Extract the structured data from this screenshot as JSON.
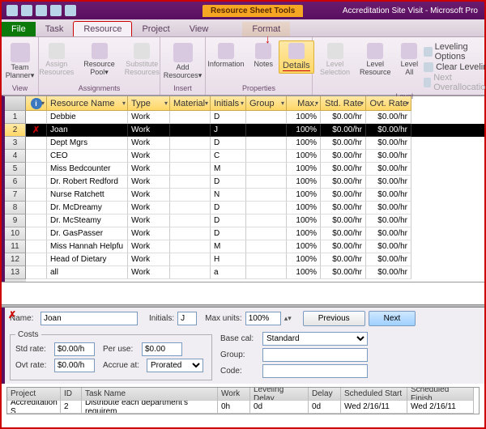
{
  "titlebar": {
    "tool_tab": "Resource Sheet Tools",
    "app_title": "Accreditation Site Visit - Microsoft Pro"
  },
  "tabs": {
    "file": "File",
    "task": "Task",
    "resource": "Resource",
    "project": "Project",
    "view": "View",
    "format": "Format"
  },
  "ribbon": {
    "team_planner": "Team\nPlanner▾",
    "assign": "Assign\nResources",
    "pool": "Resource\nPool▾",
    "substitute": "Substitute\nResources",
    "assignments": "Assignments",
    "add": "Add\nResources▾",
    "insert": "Insert",
    "info": "Information",
    "notes": "Notes",
    "details": "Details",
    "properties": "Properties",
    "lvl_sel": "Level\nSelection",
    "lvl_res": "Level\nResource",
    "lvl_all": "Level\nAll",
    "lvl_opts": "Leveling Options",
    "clear_lvl": "Clear Leveling",
    "next_over": "Next Overallocation",
    "level": "Level",
    "view_group": "View"
  },
  "columns": {
    "indicator": "i",
    "name": "Resource Name",
    "type": "Type",
    "material": "Material",
    "initials": "Initials",
    "group": "Group",
    "max": "Max.",
    "std": "Std. Rate",
    "ovt": "Ovt. Rate"
  },
  "rows": [
    {
      "n": "1",
      "name": "Debbie",
      "type": "Work",
      "init": "D",
      "max": "100%",
      "std": "$0.00/hr",
      "ovt": "$0.00/hr"
    },
    {
      "n": "2",
      "name": "Joan",
      "type": "Work",
      "init": "J",
      "max": "100%",
      "std": "$0.00/hr",
      "ovt": "$0.00/hr",
      "selected": true,
      "ind": "✗"
    },
    {
      "n": "3",
      "name": "Dept Mgrs",
      "type": "Work",
      "init": "D",
      "max": "100%",
      "std": "$0.00/hr",
      "ovt": "$0.00/hr"
    },
    {
      "n": "4",
      "name": "CEO",
      "type": "Work",
      "init": "C",
      "max": "100%",
      "std": "$0.00/hr",
      "ovt": "$0.00/hr"
    },
    {
      "n": "5",
      "name": "Miss Bedcounter",
      "type": "Work",
      "init": "M",
      "max": "100%",
      "std": "$0.00/hr",
      "ovt": "$0.00/hr"
    },
    {
      "n": "6",
      "name": "Dr. Robert Redford",
      "type": "Work",
      "init": "D",
      "max": "100%",
      "std": "$0.00/hr",
      "ovt": "$0.00/hr"
    },
    {
      "n": "7",
      "name": "Nurse Ratchett",
      "type": "Work",
      "init": "N",
      "max": "100%",
      "std": "$0.00/hr",
      "ovt": "$0.00/hr"
    },
    {
      "n": "8",
      "name": "Dr. McDreamy",
      "type": "Work",
      "init": "D",
      "max": "100%",
      "std": "$0.00/hr",
      "ovt": "$0.00/hr"
    },
    {
      "n": "9",
      "name": "Dr. McSteamy",
      "type": "Work",
      "init": "D",
      "max": "100%",
      "std": "$0.00/hr",
      "ovt": "$0.00/hr"
    },
    {
      "n": "10",
      "name": "Dr. GasPasser",
      "type": "Work",
      "init": "D",
      "max": "100%",
      "std": "$0.00/hr",
      "ovt": "$0.00/hr"
    },
    {
      "n": "11",
      "name": "Miss Hannah Helpfu",
      "type": "Work",
      "init": "M",
      "max": "100%",
      "std": "$0.00/hr",
      "ovt": "$0.00/hr"
    },
    {
      "n": "12",
      "name": "Head of Dietary",
      "type": "Work",
      "init": "H",
      "max": "100%",
      "std": "$0.00/hr",
      "ovt": "$0.00/hr"
    },
    {
      "n": "13",
      "name": "all",
      "type": "Work",
      "init": "a",
      "max": "100%",
      "std": "$0.00/hr",
      "ovt": "$0.00/hr"
    }
  ],
  "detail": {
    "name_label": "Name:",
    "name_value": "Joan",
    "initials_label": "Initials:",
    "initials_value": "J",
    "maxunits_label": "Max units:",
    "maxunits_value": "100%",
    "previous": "Previous",
    "next": "Next",
    "costs_legend": "Costs",
    "std_label": "Std rate:",
    "std_value": "$0.00/h",
    "ovt_label": "Ovt rate:",
    "ovt_value": "$0.00/h",
    "per_label": "Per use:",
    "per_value": "$0.00",
    "accrue_label": "Accrue at:",
    "accrue_value": "Prorated",
    "basecal_label": "Base cal:",
    "basecal_value": "Standard",
    "group_label": "Group:",
    "code_label": "Code:"
  },
  "taskcols": {
    "project": "Project",
    "id": "ID",
    "task": "Task Name",
    "work": "Work",
    "lvl": "Leveling Delay",
    "delay": "Delay",
    "ss": "Scheduled Start",
    "sf": "Scheduled Finish"
  },
  "task": {
    "project": "Accreditation S",
    "id": "2",
    "name": "Distribute each department's requirem",
    "work": "0h",
    "lvl": "0d",
    "delay": "0d",
    "ss": "Wed 2/16/11",
    "sf": "Wed 2/16/11"
  }
}
